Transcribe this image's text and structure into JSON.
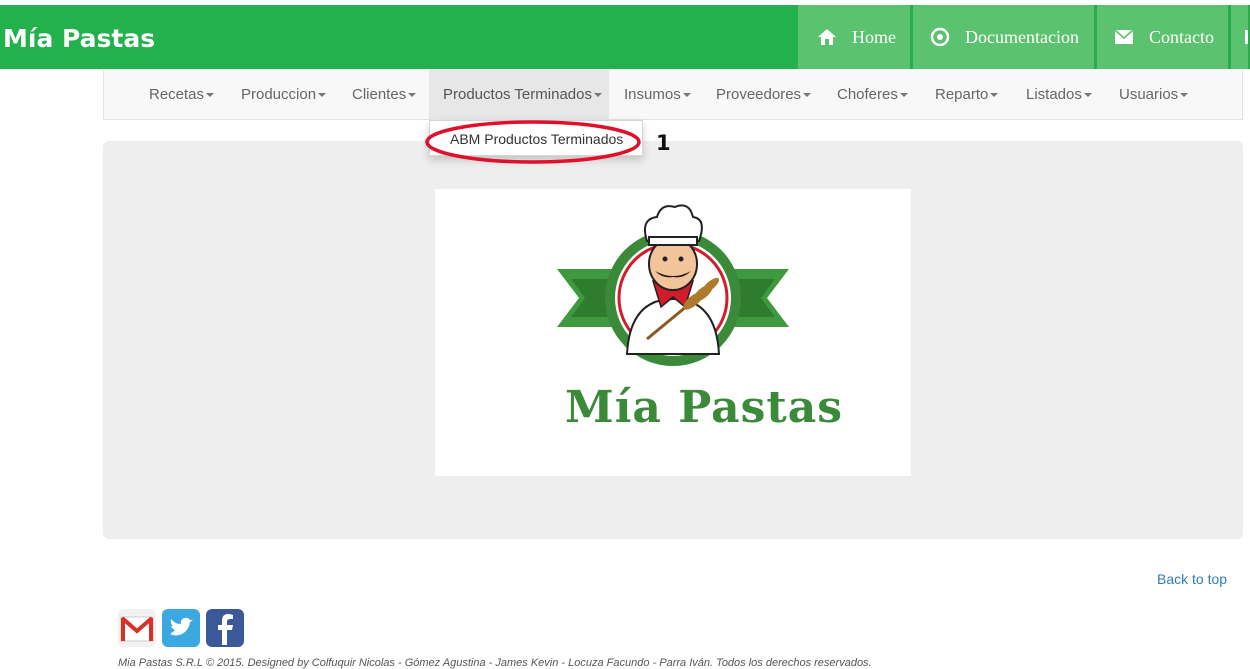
{
  "header": {
    "brand": "Mía Pastas",
    "buttons": [
      {
        "label": "Home",
        "icon": "home-icon"
      },
      {
        "label": "Documentacion",
        "icon": "registered-icon"
      },
      {
        "label": "Contacto",
        "icon": "envelope-icon"
      }
    ],
    "green": "#22b14c",
    "button_green": "#5bc26f"
  },
  "navbar": {
    "items": [
      "Recetas",
      "Produccion",
      "Clientes",
      "Productos Terminados",
      "Insumos",
      "Proveedores",
      "Choferes",
      "Reparto",
      "Listados",
      "Usuarios"
    ],
    "active_item": "Productos Terminados"
  },
  "dropdown": {
    "items": [
      "ABM Productos Terminados"
    ]
  },
  "annotation": {
    "step_number": "1",
    "highlight_color": "#e0102a"
  },
  "logo": {
    "text": "Mía Pastas",
    "icon": "chef-logo-icon"
  },
  "footer": {
    "back_to_top": "Back to top",
    "social_icons": [
      "gmail-icon",
      "twitter-icon",
      "facebook-icon"
    ],
    "copyright": "Mia Pastas S.R.L © 2015. Designed by Colfuquir Nicolas - Gómez Agustina - James Kevin - Locuza Facundo - Parra Iván. Todos los derechos reservados."
  }
}
